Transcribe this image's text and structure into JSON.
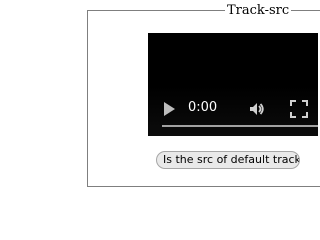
{
  "fieldset": {
    "legend": "Track-src"
  },
  "video": {
    "time_display": "0:00",
    "progress": 0,
    "icons": {
      "play": "play-icon",
      "volume": "volume-icon",
      "fullscreen": "fullscreen-icon"
    },
    "colors": {
      "background": "#000000",
      "controls_text": "#ffffff"
    }
  },
  "check_button": {
    "label": "Is the src of default track trus"
  }
}
